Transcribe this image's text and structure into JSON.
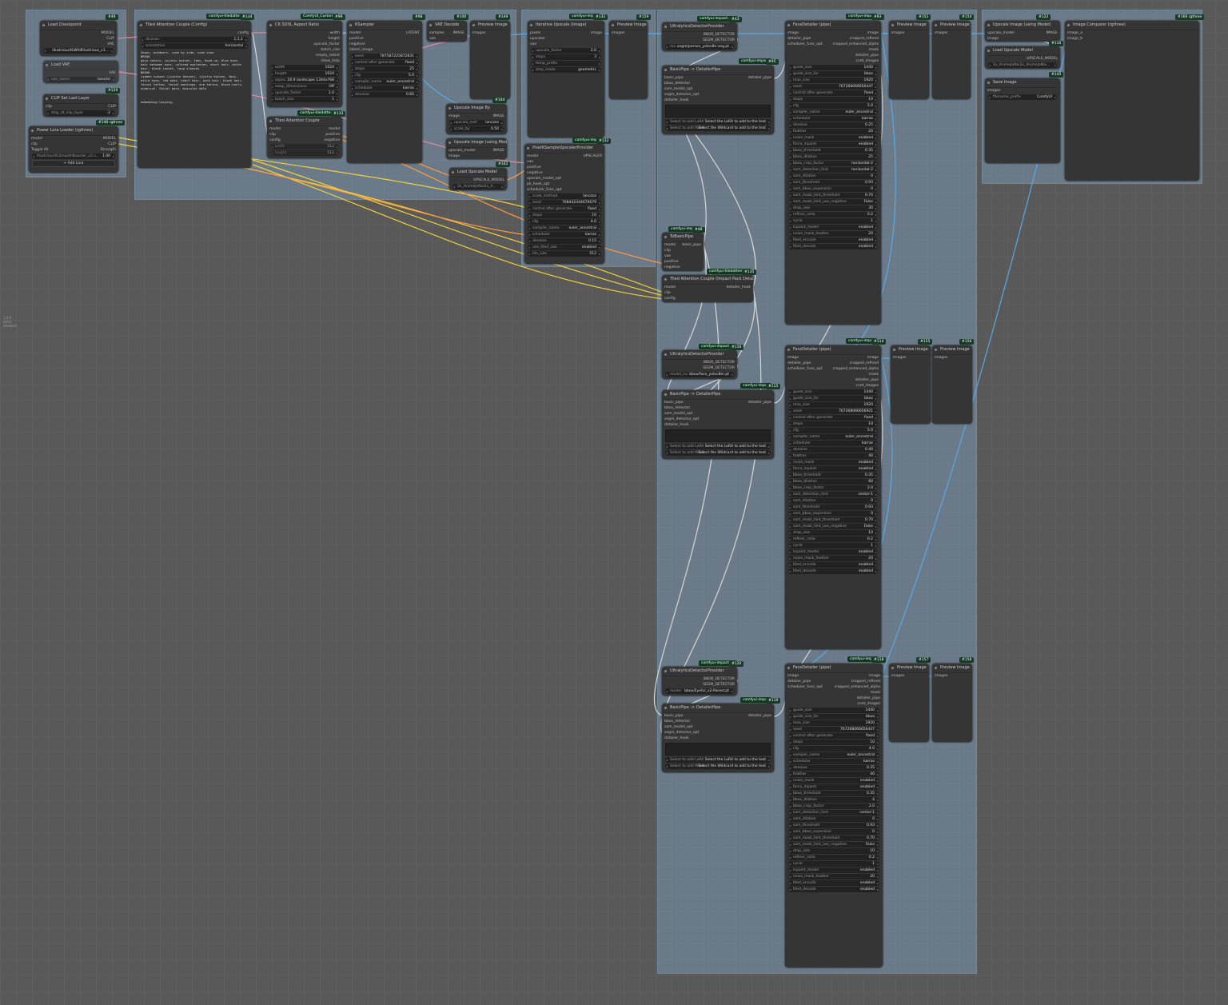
{
  "lod_text": "1.0.0\nextra\nfrontend",
  "groups_count": 4,
  "nodes": {
    "n49": {
      "id": "#49",
      "title": "Load Checkpoint",
      "outputs": [
        "MODEL",
        "CLIP",
        "VAE"
      ],
      "ckpt": "illustriousXLWAIIIllustrious_v1..."
    },
    "vae": {
      "title": "Load VAE",
      "output": "VAE",
      "vae_name": "vae_name",
      "vae_value": "taesdxl"
    },
    "n129": {
      "id": "#129",
      "title": "CLIP Set Last Layer",
      "input": "clip",
      "output": "CLIP",
      "stop_label": "stop_at_clip_layer",
      "stop_value": "-2"
    },
    "n146": {
      "id": "#146 rgthree",
      "title": "Power Lora Loader (rgthree)",
      "in_model": "model",
      "in_clip": "clip",
      "out_model": "MODEL",
      "out_clip": "CLIP",
      "toggle": "Toggle All",
      "strength": "Strength",
      "lora": "IllustriousXLSmoothBooster_v2.s...",
      "lora_val": "1.00",
      "add": "+ Add Lora"
    },
    "n134": {
      "id": "#134",
      "ext": "comfyui-tiledattention",
      "title": "Tiled Attention Couple (Config)",
      "out": "config",
      "division_label": "division",
      "division_value": "1,1,1",
      "orient_label": "orientation",
      "orient_value": "horizontal",
      "prompt": "2boys, outdoors, side by side, side view\nBREAK\ngojo satoru, jujutsu kaisen, 1boy, hand up, blue eyes, hair between eyes, colored eyelashes, short hair, white hair, black jacket, long sleeves\nBREAK\nryomen sukuna (jujutsu kaisen), jujutsu kaisen, 1boy, extra eyes, red eyes, short hair, pink hair, black hair, facial tattoo, facial markings, arm tattoo, black nails, undercut, facial mark, muscular male",
      "neg": "embedding:lazyneg,"
    },
    "n99": {
      "id": "#99",
      "ext": "ComfyUI_Custom9",
      "title": "CR SDXL Aspect Ratio",
      "outs": [
        "width",
        "height",
        "upscale_factor",
        "batch_size",
        "empty_latent",
        "show_help"
      ],
      "width": "1024",
      "height": "1024",
      "aspect_label": "aspec...",
      "aspect_value": "16:9 landscape 1344x768",
      "swap": "swap_dimensions",
      "swap_v": "Off",
      "upscale": "upscale_factor",
      "upscale_v": "1.0",
      "batch": "batch_size",
      "batch_v": "1"
    },
    "n133": {
      "id": "#133",
      "ext": "comfyui-tiledattention",
      "title": "Tiled Attention Couple",
      "ins": [
        "model",
        "clip",
        "config"
      ],
      "outs": [
        "model",
        "positive",
        "negative"
      ],
      "width": "width",
      "height": "height",
      "w_v": "512",
      "h_v": "512"
    },
    "n98": {
      "id": "#98",
      "title": "KSampler",
      "ins": [
        "model",
        "positive",
        "negative",
        "latent_image"
      ],
      "out": "LATENT",
      "seed": "787587225872831",
      "control": "fixed",
      "steps": "25",
      "cfg": "5.0",
      "sampler": "euler_ancestral",
      "scheduler": "karras",
      "denoise": "0.60"
    },
    "n100": {
      "id": "#100",
      "title": "VAE Decode",
      "ins": [
        "samples",
        "vae"
      ],
      "out": "IMAGE"
    },
    "n149": {
      "id": "#149",
      "title": "Preview Image",
      "in": "images"
    },
    "n104": {
      "id": "#104",
      "title": "Upscale Image By",
      "in": "image",
      "out": "IMAGE",
      "method": "lanczos",
      "scale": "0.50"
    },
    "upm": {
      "title": "Upscale Image (using Model)",
      "ins": [
        "upscale_model",
        "image"
      ],
      "out": "IMAGE"
    },
    "n162": {
      "id": "#162",
      "title": "Load Upscale Model",
      "out": "UPSCALE_MODEL",
      "model": "2x_AniméJaNai2x_A..."
    },
    "n131": {
      "id": "#131",
      "ext": "comfyui-impac",
      "title": "Iterative Upscale (Image)",
      "ins": [
        "pixels",
        "upscaler",
        "vae"
      ],
      "out": "image",
      "factor": "2.0",
      "steps": "3",
      "prefix": "temp_prefix",
      "mode": "geometric"
    },
    "n159": {
      "id": "#159",
      "title": "Preview Image",
      "in": "images"
    },
    "n132": {
      "id": "#132",
      "ext": "comfyui-impac",
      "title": "PixelKSampleUpscalerProvider",
      "ins": [
        "model",
        "vae",
        "positive",
        "negative",
        "upscale_model_opt",
        "pk_hook_opt",
        "scheduler_func_opt"
      ],
      "out": "UPSCALER",
      "method": "lanczos",
      "seed": "768442344670679",
      "control": "fixed",
      "steps": "10",
      "cfg": "4.0",
      "sampler": "euler_ancestral",
      "scheduler": "karras",
      "denoise": "0.15",
      "tiled": "enabled",
      "tile": "512"
    },
    "n43": {
      "id": "#43",
      "ext": "comfyui-impact-sub",
      "title": "UltralyticsDetectorProvider",
      "outs": [
        "BBOX_DETECTOR",
        "SEGM_DETECTOR"
      ],
      "model": "segm/person_yolov8n-seg.pt"
    },
    "n95": {
      "id": "#95",
      "ext": "comfyui-impact",
      "title": "BasicPipe -> DetailerPipe",
      "ins": [
        "basic_pipe",
        "bbox_detector",
        "sam_model_opt",
        "segm_detector_opt",
        "detailer_hook"
      ],
      "out": "detailer_pipe",
      "lora": "Select the LoRA to add to the text",
      "wild": "Select the Wildcard to add to the text"
    },
    "n48": {
      "id": "#48",
      "ext": "comfyui-impact",
      "title": "ToBasicPipe",
      "ins": [
        "model",
        "clip",
        "vae",
        "positive",
        "negative"
      ],
      "out": "basic_pipe"
    },
    "n135": {
      "id": "#135",
      "ext": "comfyui-tiledattention",
      "title": "Tiled Attention Couple (Impact Pack Detailer)",
      "ins": [
        "model",
        "clip",
        "config"
      ],
      "out": "detailer_hook"
    },
    "n116": {
      "id": "#116",
      "ext": "comfyui-impact-su",
      "title": "UltralyticsDetectorProvider",
      "outs": [
        "BBOX_DETECTOR",
        "SEGM_DETECTOR"
      ],
      "model": "bbox/face_yolov8m.pt"
    },
    "n115": {
      "id": "#115",
      "ext": "comfyui-impac",
      "title": "BasicPipe -> DetailerPipe"
    },
    "n120": {
      "id": "#120",
      "ext": "comfyui-impact-su",
      "title": "UltralyticsDetectorProvider",
      "model": "bbox/Eyeful_v2-Paired.pt"
    },
    "n119": {
      "id": "#119",
      "ext": "comfyui-impac",
      "title": "BasicPipe -> DetailerPipe"
    },
    "n93": {
      "id": "#93",
      "ext": "comfyui-impac",
      "title": "FaceDetailer (pipe)",
      "ins": [
        "image",
        "detailer_pipe",
        "scheduler_func_opt"
      ],
      "outs": [
        "image",
        "cropped_refined",
        "cropped_enhanced_alpha",
        "mask",
        "detailer_pipe",
        "cnet_images"
      ],
      "rows": [
        [
          "guide_size",
          "1440"
        ],
        [
          "guide_size_for",
          "bbox"
        ],
        [
          "max_size",
          "1920"
        ],
        [
          "seed",
          "767268066656447"
        ],
        [
          "control after generate",
          "fixed"
        ],
        [
          "steps",
          "10"
        ],
        [
          "cfg",
          "5.0"
        ],
        [
          "sampler_name",
          "euler_ancestral"
        ],
        [
          "scheduler",
          "karras"
        ],
        [
          "denoise",
          "0.25"
        ],
        [
          "feather",
          "20"
        ],
        [
          "noise_mask",
          "enabled"
        ],
        [
          "force_inpaint",
          "enabled"
        ],
        [
          "bbox_threshold",
          "0.35"
        ],
        [
          "bbox_dilation",
          "25"
        ],
        [
          "bbox_crop_factor",
          "horizontal-2"
        ],
        [
          "sam_detection_hint",
          "horizontal-2"
        ],
        [
          "sam_dilation",
          "0"
        ],
        [
          "sam_threshold",
          "0.93"
        ],
        [
          "sam_bbox_expansion",
          "0"
        ],
        [
          "sam_mask_hint_threshold",
          "0.70"
        ],
        [
          "sam_mask_hint_use_negative",
          "False"
        ],
        [
          "drop_size",
          "30"
        ],
        [
          "refiner_ratio",
          "0.2"
        ],
        [
          "cycle",
          "1"
        ],
        [
          "inpaint_model",
          "enabled"
        ],
        [
          "noise_mask_feather",
          "20"
        ],
        [
          "tiled_encode",
          "enabled"
        ],
        [
          "tiled_decode",
          "enabled"
        ]
      ]
    },
    "n114": {
      "id": "#114",
      "ext": "comfyui-impac",
      "title": "FaceDetailer (pipe)",
      "rows": [
        [
          "guide_size",
          "1440"
        ],
        [
          "guide_size_for",
          "bbox"
        ],
        [
          "max_size",
          "1920"
        ],
        [
          "seed",
          "767268066656921"
        ],
        [
          "control after generate",
          "fixed"
        ],
        [
          "steps",
          "10"
        ],
        [
          "cfg",
          "5.0"
        ],
        [
          "sampler_name",
          "euler_ancestral"
        ],
        [
          "scheduler",
          "karras"
        ],
        [
          "denoise",
          "0.40"
        ],
        [
          "feather",
          "40"
        ],
        [
          "noise_mask",
          "enabled"
        ],
        [
          "force_inpaint",
          "enabled"
        ],
        [
          "bbox_threshold",
          "0.35"
        ],
        [
          "bbox_dilation",
          "60"
        ],
        [
          "bbox_crop_factor",
          "2.0"
        ],
        [
          "sam_detection_hint",
          "center-1"
        ],
        [
          "sam_dilation",
          "0"
        ],
        [
          "sam_threshold",
          "0.93"
        ],
        [
          "sam_bbox_expansion",
          "0"
        ],
        [
          "sam_mask_hint_threshold",
          "0.70"
        ],
        [
          "sam_mask_hint_use_negative",
          "False"
        ],
        [
          "drop_size",
          "10"
        ],
        [
          "refiner_ratio",
          "0.2"
        ],
        [
          "cycle",
          "1"
        ],
        [
          "inpaint_model",
          "enabled"
        ],
        [
          "noise_mask_feather",
          "20"
        ],
        [
          "tiled_encode",
          "enabled"
        ],
        [
          "tiled_decode",
          "enabled"
        ]
      ]
    },
    "n118": {
      "id": "#118",
      "ext": "comfyui-impac",
      "title": "FaceDetailer (pipe)",
      "rows": [
        [
          "guide_size",
          "1440"
        ],
        [
          "guide_size_for",
          "bbox"
        ],
        [
          "max_size",
          "1920"
        ],
        [
          "seed",
          "767268066656447"
        ],
        [
          "control after generate",
          "fixed"
        ],
        [
          "steps",
          "10"
        ],
        [
          "cfg",
          "4.0"
        ],
        [
          "sampler_name",
          "euler_ancestral"
        ],
        [
          "scheduler",
          "karras"
        ],
        [
          "denoise",
          "0.35"
        ],
        [
          "feather",
          "40"
        ],
        [
          "noise_mask",
          "enabled"
        ],
        [
          "force_inpaint",
          "enabled"
        ],
        [
          "bbox_threshold",
          "0.35"
        ],
        [
          "bbox_dilation",
          "4"
        ],
        [
          "bbox_crop_factor",
          "2.0"
        ],
        [
          "sam_detection_hint",
          "center-1"
        ],
        [
          "sam_dilation",
          "0"
        ],
        [
          "sam_threshold",
          "0.93"
        ],
        [
          "sam_bbox_expansion",
          "0"
        ],
        [
          "sam_mask_hint_threshold",
          "0.70"
        ],
        [
          "sam_mask_hint_use_negative",
          "False"
        ],
        [
          "drop_size",
          "10"
        ],
        [
          "refiner_ratio",
          "0.2"
        ],
        [
          "cycle",
          "1"
        ],
        [
          "inpaint_model",
          "enabled"
        ],
        [
          "noise_mask_feather",
          "20"
        ],
        [
          "tiled_encode",
          "enabled"
        ],
        [
          "tiled_decode",
          "enabled"
        ]
      ]
    },
    "n151": {
      "id": "#151",
      "title": "Preview Image",
      "in": "images"
    },
    "n154": {
      "id": "#154",
      "title": "Preview Image",
      "in": "images"
    },
    "n155": {
      "id": "#155",
      "title": "Preview Image",
      "in": "images"
    },
    "n156": {
      "id": "#156",
      "title": "Preview Image",
      "in": "images"
    },
    "n157": {
      "id": "#157",
      "title": "Preview Image",
      "in": "images"
    },
    "n158": {
      "id": "#158",
      "title": "Preview Image",
      "in": "images"
    },
    "n122": {
      "id": "#122",
      "title": "Upscale Image (using Model)",
      "ins": [
        "upscale_model",
        "image"
      ],
      "out": "IMAGE"
    },
    "n110": {
      "id": "#110",
      "title": "Load Upscale Model",
      "out": "UPSCALE_MODEL",
      "model": "2x_AnimeJaNai2x_AnimeJaNai..."
    },
    "n145": {
      "id": "#145",
      "title": "Save Image",
      "in": "images",
      "prefix_label": "filename_prefix",
      "prefix": "ComfyUI"
    },
    "n166": {
      "id": "#166 rgthree",
      "title": "Image Comparer (rgthree)",
      "ins": [
        "image_a",
        "image_b"
      ]
    }
  },
  "colors": {
    "canvas": "#595959",
    "node": "#353535",
    "group": "#7b98b0",
    "wire_yellow": "#f2d13a",
    "wire_blue": "#5aa9e6",
    "wire_pink": "#e58aa0",
    "wire_white": "#d8d8d8",
    "wire_orange": "#ff9944"
  }
}
